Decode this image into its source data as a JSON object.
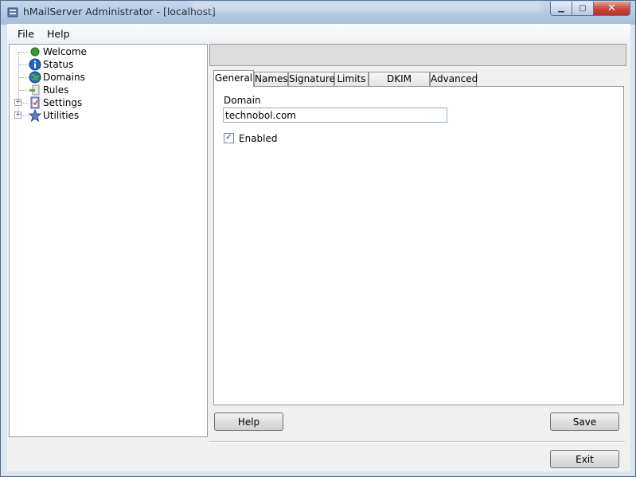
{
  "window": {
    "title": "hMailServer Administrator - [localhost]",
    "controls": {
      "minimize": "▁",
      "maximize": "▢",
      "close": "✕"
    }
  },
  "menu": [
    {
      "label": "File"
    },
    {
      "label": "Help"
    }
  ],
  "tree": [
    {
      "label": "Welcome",
      "icon": "green-dot-icon",
      "expandable": false
    },
    {
      "label": "Status",
      "icon": "info-icon",
      "expandable": false
    },
    {
      "label": "Domains",
      "icon": "globe-icon",
      "expandable": false
    },
    {
      "label": "Rules",
      "icon": "rules-icon",
      "expandable": false
    },
    {
      "label": "Settings",
      "icon": "checklist-icon",
      "expandable": true
    },
    {
      "label": "Utilities",
      "icon": "star-icon",
      "expandable": true
    }
  ],
  "tabs": [
    {
      "label": "General",
      "active": true
    },
    {
      "label": "Names",
      "active": false
    },
    {
      "label": "Signature",
      "active": false
    },
    {
      "label": "Limits",
      "active": false
    },
    {
      "label": "DKIM Signing",
      "active": false
    },
    {
      "label": "Advanced",
      "active": false
    }
  ],
  "general": {
    "domain_label": "Domain",
    "domain_value": "technobol.com",
    "enabled_label": "Enabled",
    "enabled_checked": true,
    "check_glyph": "✓"
  },
  "buttons": {
    "help": "Help",
    "save": "Save",
    "exit": "Exit"
  },
  "colors": {
    "close_button": "#c7443a",
    "titlebar": "#a8c0dc",
    "globe": "#2a6fb0",
    "info": "#1f63c6",
    "green_dot": "#3a9a3a",
    "star": "#5b7fc2"
  }
}
